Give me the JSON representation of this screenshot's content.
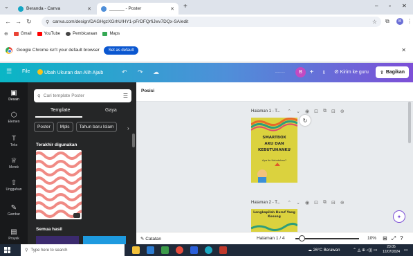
{
  "browser": {
    "tabs": [
      {
        "label": "Beranda - Canva",
        "active": false
      },
      {
        "label": "______ - Poster",
        "active": true
      }
    ],
    "new_tab": "+",
    "window_controls": {
      "minimize": "–",
      "maximize": "▫",
      "close": "✕"
    },
    "address": "canva.com/design/DAGHgzXGrhU/HY1-pFrDFQrfiJwv7DQx-SA/edit",
    "profile_initial": "B",
    "bookmarks": [
      "Gmail",
      "YouTube",
      "Pembicaraan",
      "Maps"
    ]
  },
  "banner": {
    "message": "Google Chrome isn't your default browser",
    "button": "Set as default",
    "close": "✕"
  },
  "canva_header": {
    "menu_icon": "☰",
    "file": "File",
    "resize": "Ubah Ukuran dan Alih Ajaib",
    "design_title": ".....",
    "avatar": "B",
    "send_to_teacher": "Kirim ke guru",
    "share": "Bagikan"
  },
  "rail": [
    {
      "label": "Desain",
      "icon": "▣"
    },
    {
      "label": "Elemen",
      "icon": "⬡"
    },
    {
      "label": "Teks",
      "icon": "T"
    },
    {
      "label": "Merek",
      "icon": "♕"
    },
    {
      "label": "Unggahan",
      "icon": "⇧"
    },
    {
      "label": "Gambar",
      "icon": "✎"
    },
    {
      "label": "Proyek",
      "icon": "▤"
    }
  ],
  "panel": {
    "search_placeholder": "Cari template Poster",
    "tabs": [
      "Template",
      "Gaya"
    ],
    "chips": [
      "Poster",
      "Mpls",
      "Tahun baru Islam"
    ],
    "recent_title": "Terakhir digunakan",
    "all_results_title": "Semua hasil"
  },
  "canvas": {
    "position_label": "Posisi",
    "pages": [
      {
        "label": "Halaman 1 - T...",
        "title_lines": [
          "SMARTBOX",
          "AKU DAN",
          "KEBUTUHANKU"
        ],
        "subtitle": "Apa itu Kebutuhan?",
        "bg": "#dbd23e"
      },
      {
        "label": "Halaman 2 - T...",
        "title_lines": [
          "Lengkapilah Huruf Yang",
          "Kosong"
        ],
        "subtitle": "",
        "bg": "#dbd23e"
      }
    ],
    "footer": {
      "notes": "Catatan",
      "page_counter": "Halaman 1 / 4",
      "zoom_label": "10%",
      "zoom_fraction": 0.1
    }
  },
  "taskbar": {
    "search_placeholder": "Type here to search",
    "weather": "26°C Berawan",
    "time": "23:05",
    "date": "12/07/2024"
  },
  "colors": {
    "header_gradient_start": "#0ab6c5",
    "header_gradient_end": "#7d4fd7",
    "panel_bg": "#252627",
    "rail_bg": "#18191b",
    "poster_yellow": "#dbd23e"
  }
}
